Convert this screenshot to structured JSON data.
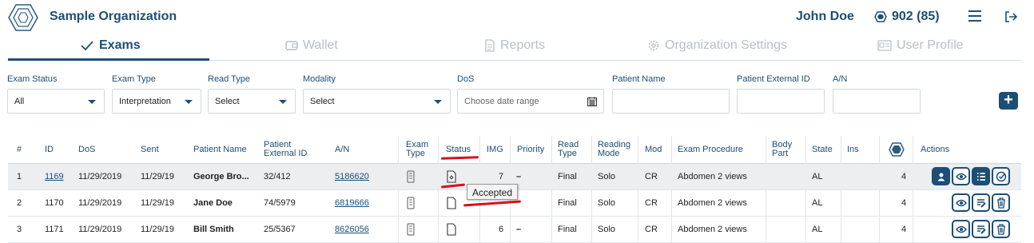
{
  "header": {
    "org_name": "Sample Organization",
    "user_name": "John Doe",
    "credits": "902 (85)"
  },
  "tabs": [
    {
      "label": "Exams",
      "active": true,
      "icon": "checkmark-icon"
    },
    {
      "label": "Wallet",
      "active": false,
      "icon": "wallet-icon"
    },
    {
      "label": "Reports",
      "active": false,
      "icon": "report-icon"
    },
    {
      "label": "Organization Settings",
      "active": false,
      "icon": "gear-icon"
    },
    {
      "label": "User Profile",
      "active": false,
      "icon": "id-card-icon"
    }
  ],
  "filters": {
    "exam_status": {
      "label": "Exam Status",
      "value": "All"
    },
    "exam_type": {
      "label": "Exam Type",
      "value": "Interpretation"
    },
    "read_type": {
      "label": "Read Type",
      "value": "Select"
    },
    "modality": {
      "label": "Modality",
      "value": "Select"
    },
    "dos": {
      "label": "DoS",
      "placeholder": "Choose date range"
    },
    "patient_name": {
      "label": "Patient Name",
      "value": ""
    },
    "patient_external_id": {
      "label": "Patient External ID",
      "value": ""
    },
    "an": {
      "label": "A/N",
      "value": ""
    },
    "add_label": "+"
  },
  "table": {
    "headers": {
      "num": "#",
      "id": "ID",
      "dos": "DoS",
      "sent": "Sent",
      "patient_name": "Patient Name",
      "patient_ext_1": "Patient",
      "patient_ext_2": "External ID",
      "an": "A/N",
      "exam_type_1": "Exam",
      "exam_type_2": "Type",
      "status": "Status",
      "img": "IMG",
      "priority": "Priority",
      "read_type_1": "Read",
      "read_type_2": "Type",
      "reading_mode_1": "Reading",
      "reading_mode_2": "Mode",
      "mod": "Mod",
      "exam_procedure": "Exam Procedure",
      "body_part_1": "Body",
      "body_part_2": "Part",
      "state": "State",
      "ins": "Ins",
      "actions": "Actions"
    },
    "rows": [
      {
        "num": "1",
        "id": "1169",
        "dos": "11/29/2019",
        "sent": "11/29/19",
        "patient_name": "George Bro...",
        "patient_ext_id": "32/412",
        "an": "5186620",
        "img": "7",
        "priority": "–",
        "read_type": "Final",
        "reading_mode": "Solo",
        "mod": "CR",
        "exam_procedure": "Abdomen 2 views",
        "body_part": "",
        "state": "AL",
        "ins": "",
        "credits": "4",
        "status_icon": "accepted-doc-icon"
      },
      {
        "num": "2",
        "id": "1170",
        "dos": "11/29/2019",
        "sent": "11/29/19",
        "patient_name": "Jane Doe",
        "patient_ext_id": "74/5979",
        "an": "6819666",
        "img": "",
        "priority": "",
        "read_type": "Final",
        "reading_mode": "Solo",
        "mod": "CR",
        "exam_procedure": "Abdomen 2 views",
        "body_part": "",
        "state": "AL",
        "ins": "",
        "credits": "4",
        "status_icon": "doc-icon"
      },
      {
        "num": "3",
        "id": "1171",
        "dos": "11/29/2019",
        "sent": "11/29/19",
        "patient_name": "Bill Smith",
        "patient_ext_id": "25/5367",
        "an": "8626056",
        "img": "6",
        "priority": "–",
        "read_type": "Final",
        "reading_mode": "Solo",
        "mod": "CR",
        "exam_procedure": "Abdomen 2 views",
        "body_part": "",
        "state": "AL",
        "ins": "",
        "credits": "4",
        "status_icon": "doc-icon"
      }
    ]
  },
  "tooltip": "Accepted",
  "colors": {
    "primary": "#1d4e75",
    "annotation": "#d8101e",
    "inactive_tab": "#b8bfc7"
  }
}
